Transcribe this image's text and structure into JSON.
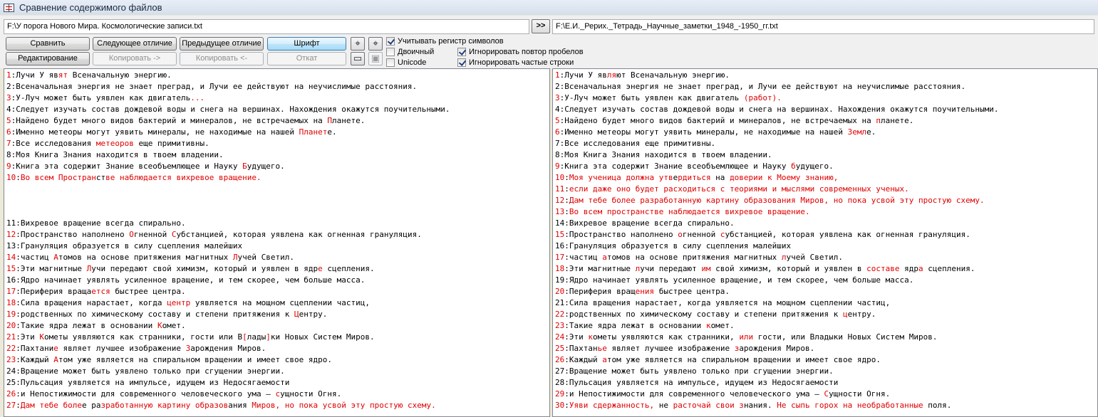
{
  "window": {
    "title": "Сравнение содержимого файлов"
  },
  "files": {
    "left_path": "F:\\У порога Нового Мира. Космологические записи.txt",
    "swap_label": ">>",
    "right_path": "F:\\Е.И._Рерих._Тетрадь_Научные_заметки_1948_-1950_гг.txt"
  },
  "buttons": {
    "compare": "Сравнить",
    "next_diff": "Следующее отличие",
    "prev_diff": "Предыдущее отличие",
    "font": "Шрифт",
    "edit": "Редактирование",
    "copy_right": "Копировать ->",
    "copy_left": "Копировать <-",
    "undo": "Откат"
  },
  "options": {
    "case_sensitive": {
      "label": "Учитывать регистр символов",
      "checked": true
    },
    "binary": {
      "label": "Двоичный",
      "checked": false
    },
    "unicode": {
      "label": "Unicode",
      "checked": false
    },
    "ignore_spaces": {
      "label": "Игнорировать повтор пробелов",
      "checked": true
    },
    "ignore_frequent": {
      "label": "Игнорировать частые строки",
      "checked": true
    }
  },
  "left_lines": [
    {
      "n": "1",
      "d": true,
      "s": [
        [
          "Лучи У яв",
          0
        ],
        [
          "ят",
          1
        ],
        [
          " Всеначальную энергию.",
          0
        ]
      ]
    },
    {
      "n": "2",
      "d": false,
      "s": [
        [
          "Всеначальная энергия не знает преград, и Лучи ее действуют на неучислимые расстояния.",
          0
        ]
      ]
    },
    {
      "n": "3",
      "d": true,
      "s": [
        [
          "У-Луч может быть уявлен как двигатель",
          0
        ],
        [
          "...",
          1
        ]
      ]
    },
    {
      "n": "4",
      "d": false,
      "s": [
        [
          "Следует изучать состав дождевой воды и снега на вершинах. Нахождения окажутся поучительными.",
          0
        ]
      ]
    },
    {
      "n": "5",
      "d": true,
      "s": [
        [
          "Найдено будет много видов бактерий и минералов, не встречаемых на ",
          0
        ],
        [
          "П",
          1
        ],
        [
          "ланете.",
          0
        ]
      ]
    },
    {
      "n": "6",
      "d": true,
      "s": [
        [
          "Именно метеоры могут уявить минералы, не находимые на нашей ",
          0
        ],
        [
          "Планет",
          1
        ],
        [
          "е.",
          0
        ]
      ]
    },
    {
      "n": "7",
      "d": true,
      "s": [
        [
          "Все исследования ",
          0
        ],
        [
          "метеоров",
          1
        ],
        [
          " еще примитивны.",
          0
        ]
      ]
    },
    {
      "n": "8",
      "d": false,
      "s": [
        [
          "Моя Книга Знания находится в твоем владении.",
          0
        ]
      ]
    },
    {
      "n": "9",
      "d": true,
      "s": [
        [
          "Книга эта содержит Знание всеобъемлющее и Науку ",
          0
        ],
        [
          "Б",
          1
        ],
        [
          "удущего.",
          0
        ]
      ]
    },
    {
      "n": "10",
      "d": true,
      "s": [
        [
          "Во всем Простран",
          1
        ],
        [
          "ст",
          0
        ],
        [
          "ве на",
          1
        ],
        [
          "блюдается вихревое вращение.",
          1
        ]
      ]
    },
    {
      "n": "",
      "d": false,
      "s": []
    },
    {
      "n": "",
      "d": false,
      "s": []
    },
    {
      "n": "",
      "d": false,
      "s": []
    },
    {
      "n": "11",
      "d": false,
      "s": [
        [
          "Вихревое вращение всегда спирально.",
          0
        ]
      ]
    },
    {
      "n": "12",
      "d": true,
      "s": [
        [
          "Пространство наполнено ",
          0
        ],
        [
          "О",
          1
        ],
        [
          "гненной ",
          0
        ],
        [
          "С",
          1
        ],
        [
          "убстанцией, которая уявлена как огненная грануляция.",
          0
        ]
      ]
    },
    {
      "n": "13",
      "d": false,
      "s": [
        [
          "Грануляция образуется в силу сцепления малейших",
          0
        ]
      ]
    },
    {
      "n": "14",
      "d": true,
      "s": [
        [
          "частиц ",
          0
        ],
        [
          "А",
          1
        ],
        [
          "томов на основе притяжения магнитных ",
          0
        ],
        [
          "Л",
          1
        ],
        [
          "учей Светил.",
          0
        ]
      ]
    },
    {
      "n": "15",
      "d": true,
      "s": [
        [
          "Эти магнитные ",
          0
        ],
        [
          "Л",
          1
        ],
        [
          "учи передают свой химизм, который и уявлен в ядр",
          0
        ],
        [
          "е",
          1
        ],
        [
          " сцепления.",
          0
        ]
      ]
    },
    {
      "n": "16",
      "d": false,
      "s": [
        [
          "Ядро начинает уявлять усиленное вращение, и тем скорее, чем больше масса.",
          0
        ]
      ]
    },
    {
      "n": "17",
      "d": true,
      "s": [
        [
          "Периферия враща",
          0
        ],
        [
          "ется",
          1
        ],
        [
          " быстрее центра.",
          0
        ]
      ]
    },
    {
      "n": "18",
      "d": true,
      "s": [
        [
          "Сила вращения нарастает, когда ",
          0
        ],
        [
          "центр",
          1
        ],
        [
          " уявляется на мощном сцеплении частиц,",
          0
        ]
      ]
    },
    {
      "n": "19",
      "d": true,
      "s": [
        [
          "родственных по химическому составу и степени притяжения к ",
          0
        ],
        [
          "Ц",
          1
        ],
        [
          "ентру.",
          0
        ]
      ]
    },
    {
      "n": "20",
      "d": true,
      "s": [
        [
          "Такие ядра лежат в основании ",
          0
        ],
        [
          "К",
          1
        ],
        [
          "омет.",
          0
        ]
      ]
    },
    {
      "n": "21",
      "d": true,
      "s": [
        [
          "Эти ",
          0
        ],
        [
          "К",
          1
        ],
        [
          "ометы уявляются как странники, гости или В",
          0
        ],
        [
          "[",
          1
        ],
        [
          "лады",
          0
        ],
        [
          "]",
          1
        ],
        [
          "ки Новых Систем Миров.",
          0
        ]
      ]
    },
    {
      "n": "22",
      "d": true,
      "s": [
        [
          "Пахтани",
          0
        ],
        [
          "е",
          1
        ],
        [
          " являет лучшее изображение ",
          0
        ],
        [
          "З",
          1
        ],
        [
          "арождения Миров.",
          0
        ]
      ]
    },
    {
      "n": "23",
      "d": true,
      "s": [
        [
          "Каждый ",
          0
        ],
        [
          "А",
          1
        ],
        [
          "том уже является на спиральном вращении и имеет свое ядро.",
          0
        ]
      ]
    },
    {
      "n": "24",
      "d": false,
      "s": [
        [
          "Вращение может быть уявлено только при сгущении энергии.",
          0
        ]
      ]
    },
    {
      "n": "25",
      "d": false,
      "s": [
        [
          "Пульсация уявляется на импульсе, идущем из Недосягаемости",
          0
        ]
      ]
    },
    {
      "n": "26",
      "d": true,
      "s": [
        [
          "и Непостижимости для современного человеческого ума — ",
          0
        ],
        [
          "с",
          1
        ],
        [
          "ущности Огня.",
          0
        ]
      ]
    },
    {
      "n": "27",
      "d": true,
      "s": [
        [
          "Дам тебе боле",
          1
        ],
        [
          "е ра",
          0
        ],
        [
          "зработанную картину образов",
          1
        ],
        [
          "ания ",
          0
        ],
        [
          "Миров, но по",
          1
        ],
        [
          "ка усвой эту простую схему.",
          1
        ]
      ]
    }
  ],
  "right_lines": [
    {
      "n": "1",
      "d": true,
      "s": [
        [
          "Лучи У яв",
          0
        ],
        [
          "ля",
          1
        ],
        [
          "ют Всеначальную энергию.",
          0
        ]
      ]
    },
    {
      "n": "2",
      "d": false,
      "s": [
        [
          "Всеначальная энергия не знает преград, и Лучи ее действуют на неучислимые расстояния.",
          0
        ]
      ]
    },
    {
      "n": "3",
      "d": true,
      "s": [
        [
          "У-Луч может быть уявлен как двигатель ",
          0
        ],
        [
          "(работ).",
          1
        ]
      ]
    },
    {
      "n": "4",
      "d": false,
      "s": [
        [
          "Следует изучать состав дождевой воды и снега на вершинах. Нахождения окажутся поучительными.",
          0
        ]
      ]
    },
    {
      "n": "5",
      "d": true,
      "s": [
        [
          "Найдено будет много видов бактерий и минералов, не встречаемых на ",
          0
        ],
        [
          "п",
          1
        ],
        [
          "ланете.",
          0
        ]
      ]
    },
    {
      "n": "6",
      "d": true,
      "s": [
        [
          "Именно метеоры могут уявить минералы, не находимые на нашей ",
          0
        ],
        [
          "Земл",
          1
        ],
        [
          "е.",
          0
        ]
      ]
    },
    {
      "n": "7",
      "d": false,
      "s": [
        [
          "Все исследования еще примитивны.",
          0
        ]
      ]
    },
    {
      "n": "8",
      "d": false,
      "s": [
        [
          "Моя Книга Знания находится в твоем владении.",
          0
        ]
      ]
    },
    {
      "n": "9",
      "d": true,
      "s": [
        [
          "Книга эта содержит Знание всеобъемлющее и Науку ",
          0
        ],
        [
          "б",
          1
        ],
        [
          "удущего.",
          0
        ]
      ]
    },
    {
      "n": "10",
      "d": true,
      "s": [
        [
          "Моя ученица должна утв",
          1
        ],
        [
          "е",
          0
        ],
        [
          "рдиться",
          1
        ],
        [
          " на ",
          0
        ],
        [
          "доверии к Моему знанию,",
          1
        ]
      ]
    },
    {
      "n": "11",
      "d": true,
      "s": [
        [
          "если даже оно будет расходиться с теориями и мыслями современных ученых.",
          1
        ]
      ]
    },
    {
      "n": "12",
      "d": true,
      "s": [
        [
          "Дам тебе более разработанную картину образования Миров, но пока усвой эту простую схему.",
          1
        ]
      ]
    },
    {
      "n": "13",
      "d": true,
      "s": [
        [
          "Во всем пространстве наблюдается вихревое вращение.",
          1
        ]
      ]
    },
    {
      "n": "14",
      "d": false,
      "s": [
        [
          "Вихревое вращение всегда спирально.",
          0
        ]
      ]
    },
    {
      "n": "15",
      "d": true,
      "s": [
        [
          "Пространство наполнено ",
          0
        ],
        [
          "о",
          1
        ],
        [
          "гненной ",
          0
        ],
        [
          "с",
          1
        ],
        [
          "убстанцией, которая уявлена как огненная грануляция.",
          0
        ]
      ]
    },
    {
      "n": "16",
      "d": false,
      "s": [
        [
          "Грануляция образуется в силу сцепления малейших",
          0
        ]
      ]
    },
    {
      "n": "17",
      "d": true,
      "s": [
        [
          "частиц ",
          0
        ],
        [
          "а",
          1
        ],
        [
          "томов на основе притяжения магнитных ",
          0
        ],
        [
          "л",
          1
        ],
        [
          "учей Светил.",
          0
        ]
      ]
    },
    {
      "n": "18",
      "d": true,
      "s": [
        [
          "Эти магнитные ",
          0
        ],
        [
          "л",
          1
        ],
        [
          "учи передают ",
          0
        ],
        [
          "им",
          1
        ],
        [
          " свой химизм, который и уявлен в ",
          0
        ],
        [
          "составе",
          1
        ],
        [
          " ядр",
          0
        ],
        [
          "а",
          1
        ],
        [
          " сцепления.",
          0
        ]
      ]
    },
    {
      "n": "19",
      "d": false,
      "s": [
        [
          "Ядро начинает уявлять усиленное вращение, и тем скорее, чем больше масса.",
          0
        ]
      ]
    },
    {
      "n": "20",
      "d": true,
      "s": [
        [
          "Периферия вращ",
          0
        ],
        [
          "ения",
          1
        ],
        [
          " быстрее центра.",
          0
        ]
      ]
    },
    {
      "n": "21",
      "d": false,
      "s": [
        [
          "Сила вращения нарастает, когда уявляется на мощном сцеплении частиц,",
          0
        ]
      ]
    },
    {
      "n": "22",
      "d": true,
      "s": [
        [
          "родственных по химическому составу и степени притяжения к ",
          0
        ],
        [
          "ц",
          1
        ],
        [
          "ентру.",
          0
        ]
      ]
    },
    {
      "n": "23",
      "d": true,
      "s": [
        [
          "Такие ядра лежат в основании ",
          0
        ],
        [
          "к",
          1
        ],
        [
          "омет.",
          0
        ]
      ]
    },
    {
      "n": "24",
      "d": true,
      "s": [
        [
          "Эти ",
          0
        ],
        [
          "к",
          1
        ],
        [
          "ометы уявляются как странники, ",
          0
        ],
        [
          "или",
          1
        ],
        [
          " гости, или Владыки Новых Систем Миров.",
          0
        ]
      ]
    },
    {
      "n": "25",
      "d": true,
      "s": [
        [
          "Пахтан",
          0
        ],
        [
          "ье",
          1
        ],
        [
          " являет лучшее изображение ",
          0
        ],
        [
          "з",
          1
        ],
        [
          "арождения Миров.",
          0
        ]
      ]
    },
    {
      "n": "26",
      "d": true,
      "s": [
        [
          "Каждый ",
          0
        ],
        [
          "а",
          1
        ],
        [
          "том уже является на спиральном вращении и имеет свое ядро.",
          0
        ]
      ]
    },
    {
      "n": "27",
      "d": false,
      "s": [
        [
          "Вращение может быть уявлено только при сгущении энергии.",
          0
        ]
      ]
    },
    {
      "n": "28",
      "d": false,
      "s": [
        [
          "Пульсация уявляется на импульсе, идущем из Недосягаемости",
          0
        ]
      ]
    },
    {
      "n": "29",
      "d": true,
      "s": [
        [
          "и Непостижимости для современного человеческого ума — ",
          0
        ],
        [
          "С",
          1
        ],
        [
          "ущности Огня.",
          0
        ]
      ]
    },
    {
      "n": "30",
      "d": true,
      "s": [
        [
          "Уяви сдержанность, ",
          1
        ],
        [
          "не ",
          0
        ],
        [
          "расточай свои з",
          1
        ],
        [
          "нания. ",
          0
        ],
        [
          "Не сыпь горох на необработанные",
          1
        ],
        [
          " поля.",
          0
        ]
      ]
    }
  ],
  "colors": {
    "diff": "#e00000",
    "accent": "#3c7fb1"
  }
}
